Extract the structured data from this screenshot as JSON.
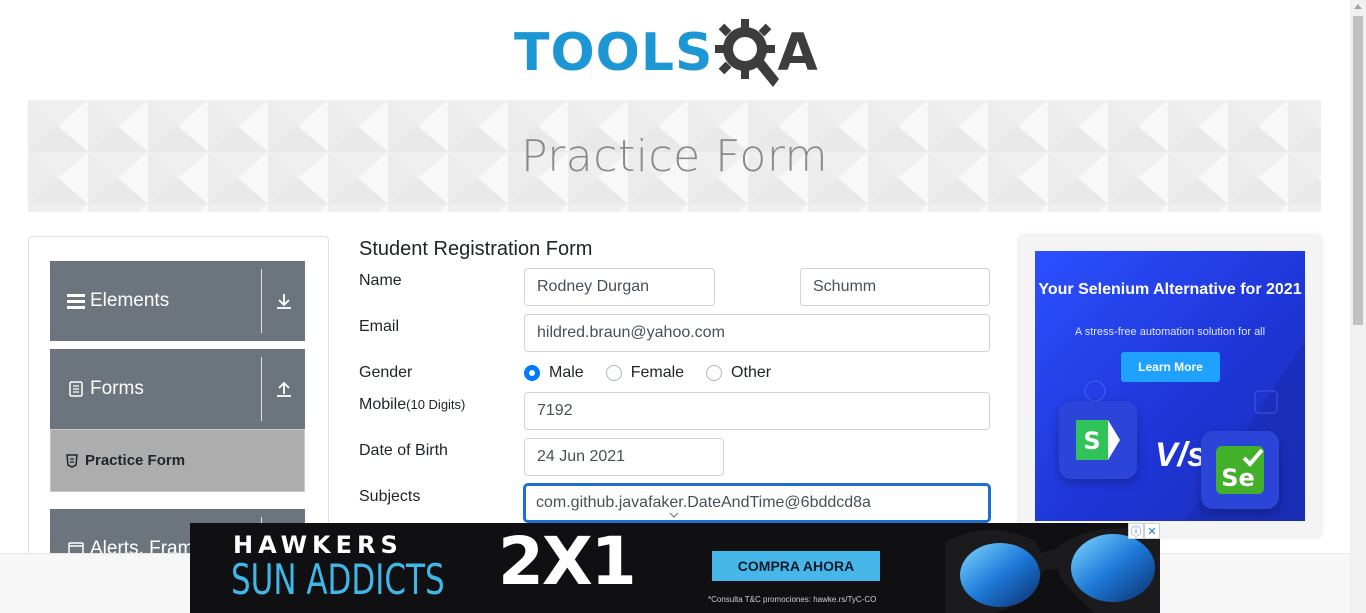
{
  "logo": {
    "part1": "TOOLS",
    "part2": "A"
  },
  "banner": {
    "title": "Practice Form"
  },
  "sidebar": {
    "groups": [
      {
        "label": "Elements",
        "icon": "hamburger-icon",
        "arrow": "download-arrow-icon"
      },
      {
        "label": "Forms",
        "icon": "document-icon",
        "arrow": "upload-arrow-icon"
      },
      {
        "label": "Alerts, Fram",
        "icon": "window-icon",
        "arrow": ""
      }
    ],
    "active_item": {
      "label": "Practice Form",
      "icon": "shield-icon"
    }
  },
  "form": {
    "title": "Student Registration Form",
    "name_label": "Name",
    "first_name": "Rodney Durgan",
    "last_name": "Schumm",
    "email_label": "Email",
    "email": "hildred.braun@yahoo.com",
    "gender_label": "Gender",
    "gender_options": [
      "Male",
      "Female",
      "Other"
    ],
    "gender_selected": "Male",
    "mobile_label": "Mobile",
    "mobile_hint": "(10 Digits)",
    "mobile": "7192",
    "dob_label": "Date of Birth",
    "dob": "24 Jun 2021",
    "subjects_label": "Subjects",
    "subjects": "com.github.javafaker.DateAndTime@6bddcd8a"
  },
  "ad_right": {
    "title": "Your Selenium Alternative for 2021",
    "subtitle": "A stress-free automation solution for all",
    "cta": "Learn More",
    "vs": "V/s",
    "logo_left": "S",
    "logo_right": "Se"
  },
  "ad_bottom": {
    "brand_top": "HAWKERS",
    "brand_bottom": "SUN ADDICTS",
    "offer": "2X1",
    "cta": "COMPRA AHORA",
    "fine_print": "*Consulta T&C promociones: hawke.rs/TyC-CO",
    "info_icon": "ⓘ",
    "close_icon": "✕"
  },
  "colors": {
    "brand_blue": "#1d97d4",
    "sidebar_bg": "#6c757d",
    "active_item": "#adadad",
    "radio": "#007bff",
    "focus": "#1f6fd1"
  }
}
